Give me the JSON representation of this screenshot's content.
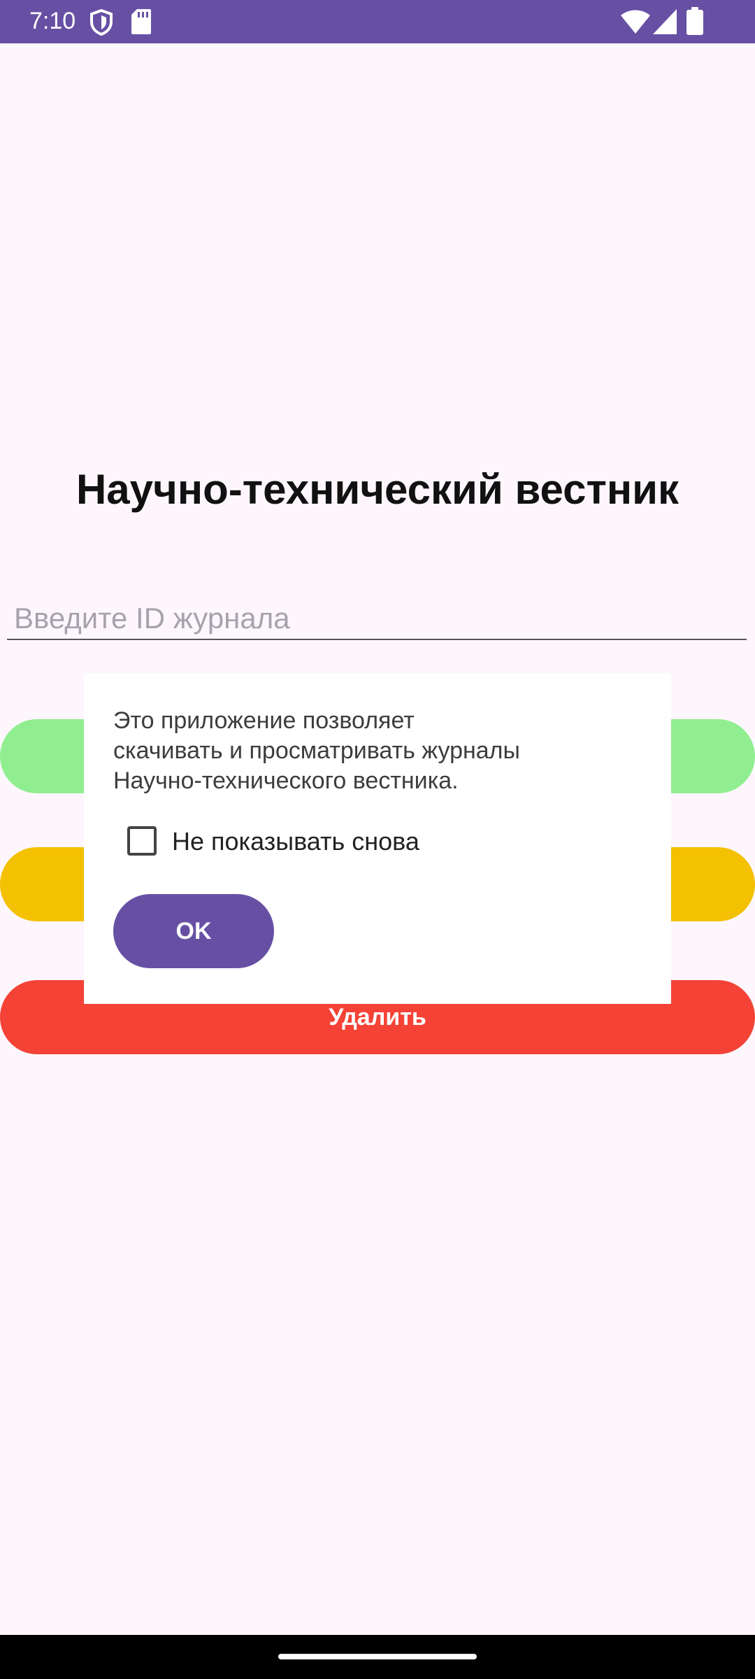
{
  "status_bar": {
    "time": "7:10",
    "icons_left": [
      "shield-icon",
      "sd-card-icon"
    ],
    "icons_right": [
      "wifi-icon",
      "signal-icon",
      "battery-icon"
    ],
    "background": "#6750A4"
  },
  "app": {
    "title": "Научно-технический вестник",
    "journal_input": {
      "value": "",
      "placeholder": "Введите ID журнала"
    },
    "buttons": {
      "delete_label": "Удалить"
    },
    "colors": {
      "background": "#FDF7FD",
      "download_button": "#90EE90",
      "view_button": "#F4C002",
      "delete_button": "#F44336"
    }
  },
  "dialog": {
    "message": "Это приложение позволяет\nскачивать и просматривать журналы\nНаучно-технического вестника.",
    "checkbox_label": "Не показывать снова",
    "checkbox_checked": false,
    "ok_label": "OK",
    "accent": "#6750A4"
  },
  "nav_bar": {
    "background": "#000000"
  }
}
